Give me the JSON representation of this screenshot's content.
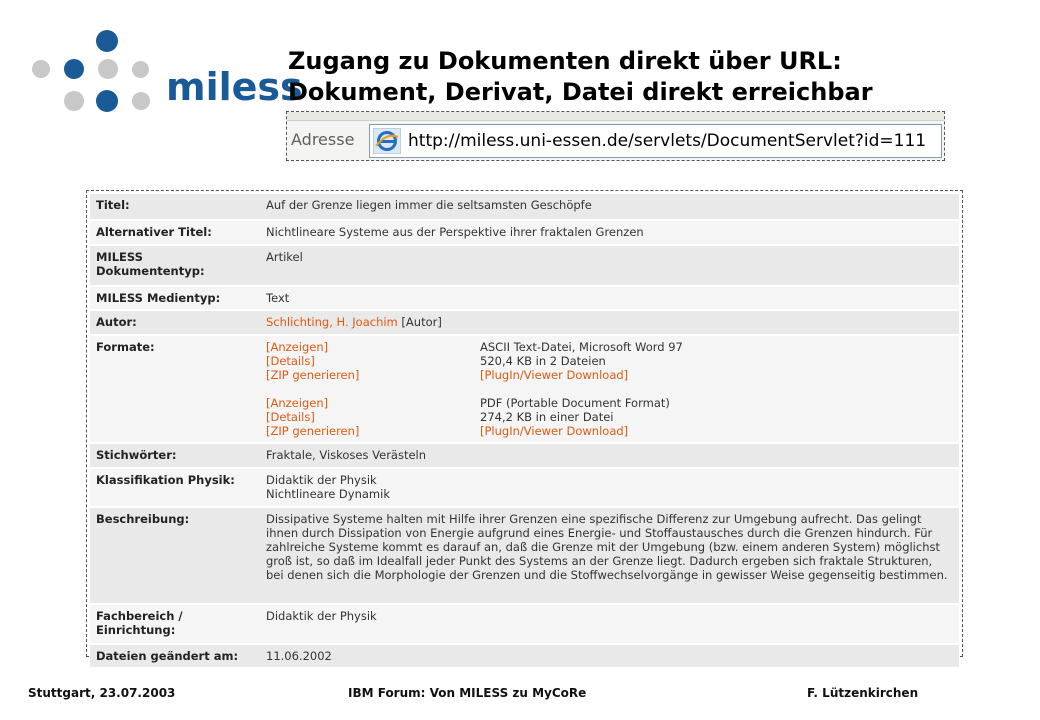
{
  "logo": {
    "text": "miless"
  },
  "title": {
    "line1": "Zugang zu Dokumenten direkt über URL:",
    "line2": "Dokument, Derivat, Datei direkt erreichbar"
  },
  "address_bar": {
    "label": "Adresse",
    "url": "http://miless.uni-essen.de/servlets/DocumentServlet?id=111"
  },
  "record": {
    "titel": {
      "label": "Titel:",
      "value": "Auf der Grenze liegen immer die seltsamsten Geschöpfe"
    },
    "alt_titel": {
      "label": "Alternativer Titel:",
      "value": "Nichtlineare Systeme aus der Perspektive ihrer fraktalen Grenzen"
    },
    "doktyp": {
      "label1": "MILESS",
      "label2": "Dokumententyp:",
      "value": "Artikel"
    },
    "medientyp": {
      "label": "MILESS Medientyp:",
      "value": "Text"
    },
    "autor": {
      "label": "Autor:",
      "link": "Schlichting, H. Joachim",
      "role": "[Autor]"
    },
    "formate": {
      "label": "Formate:",
      "groups": [
        {
          "show": "[Anzeigen]",
          "details": "[Details]",
          "zip": "[ZIP generieren]",
          "type": "ASCII Text-Datei, Microsoft Word 97",
          "size": "520,4 KB in 2 Dateien",
          "plugin": "[PlugIn/Viewer Download]"
        },
        {
          "show": "[Anzeigen]",
          "details": "[Details]",
          "zip": "[ZIP generieren]",
          "type": "PDF (Portable Document Format)",
          "size": "274,2 KB in einer Datei",
          "plugin": "[PlugIn/Viewer Download]"
        }
      ]
    },
    "stichwoerter": {
      "label": "Stichwörter:",
      "value": "Fraktale, Viskoses Verästeln"
    },
    "klassifikation": {
      "label": "Klassifikation Physik:",
      "value1": "Didaktik der Physik",
      "value2": "Nichtlineare Dynamik"
    },
    "beschreibung": {
      "label": "Beschreibung:",
      "value": "Dissipative Systeme halten mit Hilfe ihrer Grenzen eine spezifische Differenz zur Umgebung aufrecht. Das gelingt ihnen durch Dissipation von Energie aufgrund eines Energie- und Stoffaustausches durch die Grenzen hindurch. Für zahlreiche Systeme kommt es darauf an, daß die Grenze mit der Umgebung (bzw. einem anderen System) möglichst groß ist, so daß im Idealfall jeder Punkt des Systems an der Grenze liegt. Dadurch ergeben sich fraktale Strukturen, bei denen sich die Morphologie der Grenzen und die Stoffwechselvorgänge in gewisser Weise gegenseitig bestimmen."
    },
    "fachbereich": {
      "label1": "Fachbereich /",
      "label2": "Einrichtung:",
      "value": "Didaktik der Physik"
    },
    "geaendert": {
      "label": "Dateien geändert am:",
      "value": "11.06.2002"
    }
  },
  "footer": {
    "left": "Stuttgart, 23.07.2003",
    "center": "IBM Forum: Von MILESS zu MyCoRe",
    "right": "F. Lützenkirchen"
  },
  "colors": {
    "brand_blue": "#1a5a96",
    "dot_grey": "#c8c8c8",
    "link": "#e05a10"
  },
  "icons": {
    "browser": "ie-icon"
  }
}
